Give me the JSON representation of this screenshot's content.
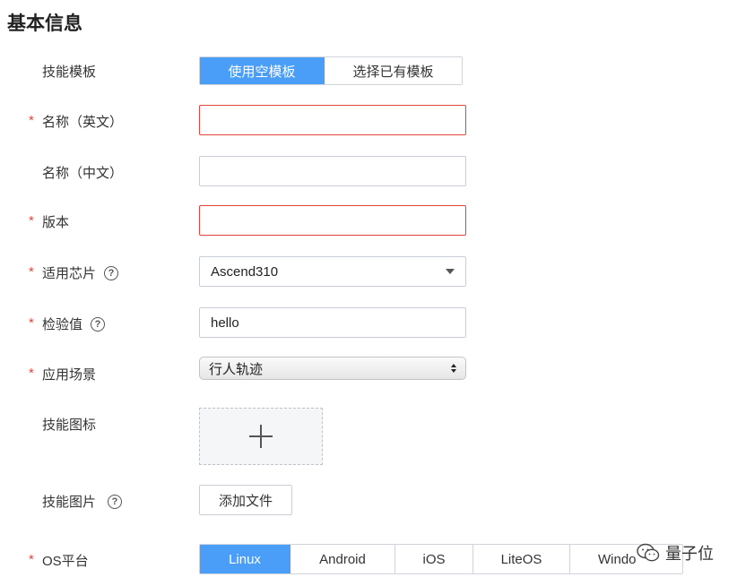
{
  "section": {
    "title": "基本信息"
  },
  "fields": {
    "template": {
      "label": "技能模板",
      "options": [
        "使用空模板",
        "选择已有模板"
      ],
      "selected": 0
    },
    "name_en": {
      "label": "名称（英文）",
      "required": "*",
      "value": ""
    },
    "name_cn": {
      "label": "名称（中文）",
      "value": ""
    },
    "version": {
      "label": "版本",
      "required": "*",
      "value": ""
    },
    "chip": {
      "label": "适用芯片",
      "required": "*",
      "help": "?",
      "value": "Ascend310"
    },
    "checksum": {
      "label": "检验值",
      "required": "*",
      "help": "?",
      "value": "hello"
    },
    "scenario": {
      "label": "应用场景",
      "required": "*",
      "value": "行人轨迹"
    },
    "icon": {
      "label": "技能图标",
      "add_glyph": "+"
    },
    "image": {
      "label": "技能图片",
      "help": "?",
      "button": "添加文件"
    },
    "os": {
      "label": "OS平台",
      "required": "*",
      "options": [
        "Linux",
        "Android",
        "iOS",
        "LiteOS",
        "Windo"
      ],
      "selected": 0
    }
  },
  "watermark": {
    "text": "量子位"
  },
  "colors": {
    "accent": "#4a9ef7",
    "error": "#e0453c"
  }
}
